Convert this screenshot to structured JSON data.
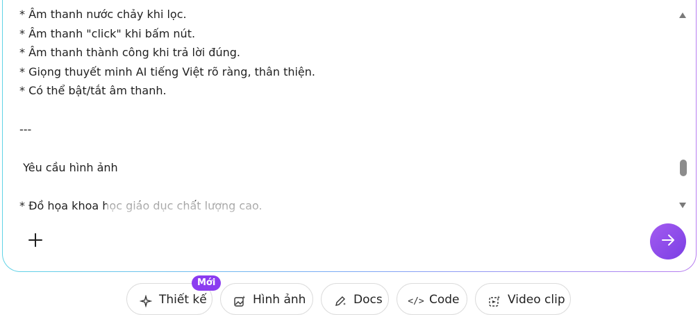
{
  "editor": {
    "lines": [
      "* Âm thanh nước chảy khi lọc.",
      "* Âm thanh \"click\" khi bấm nút.",
      "* Âm thanh thành công khi trả lời đúng.",
      "* Giọng thuyết minh AI tiếng Việt rõ ràng, thân thiện.",
      "* Có thể bật/tắt âm thanh.",
      "",
      "---",
      "",
      " Yêu cầu hình ảnh",
      "",
      "* Đồ họa khoa học giáo dục chất lượng cao."
    ]
  },
  "toolbar": {
    "add_icon": "plus-icon",
    "send_icon": "arrow-right-icon",
    "send_color": "#8b3cf0"
  },
  "chips": [
    {
      "label": "Thiết kế",
      "icon": "sparkle-icon",
      "badge": "Mới"
    },
    {
      "label": "Hình ảnh",
      "icon": "image-sparkle-icon"
    },
    {
      "label": "Docs",
      "icon": "pen-sparkle-icon"
    },
    {
      "label": "Code",
      "icon": "code-icon"
    },
    {
      "label": "Video clip",
      "icon": "video-sparkle-icon"
    }
  ]
}
